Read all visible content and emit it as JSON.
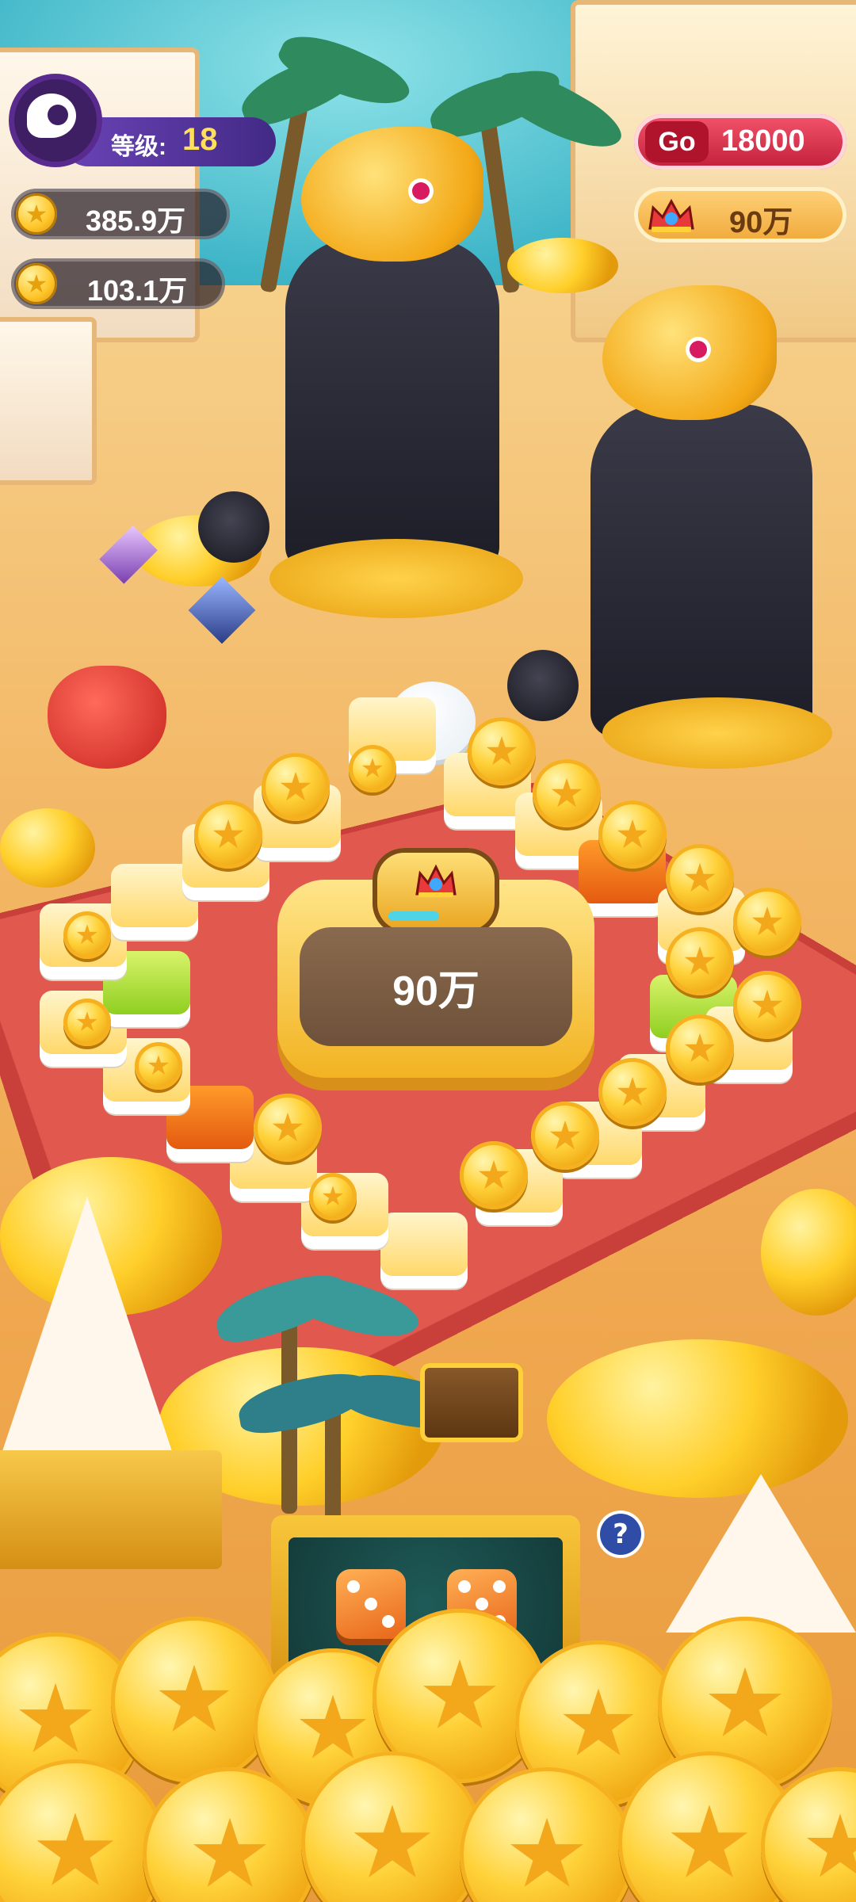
{
  "hud": {
    "level_label": "等级:",
    "level_value": "18",
    "coins_primary": "385.9万",
    "coins_secondary": "103.1万",
    "go_badge": "Go",
    "go_value": "18000",
    "crown_value": "90万"
  },
  "board": {
    "center_value": "90万"
  },
  "dice": {
    "faces": [
      3,
      5
    ],
    "help_label": "?"
  },
  "colors": {
    "hud_purple": "#432a86",
    "go_red": "#c11e3a",
    "gold": "#ffd23a",
    "carpet_red": "#e0584e"
  },
  "icons": {
    "avatar": "mascot-avatar-icon",
    "coin": "gold-coin-icon",
    "crown": "crown-icon",
    "help": "question-mark-icon"
  }
}
